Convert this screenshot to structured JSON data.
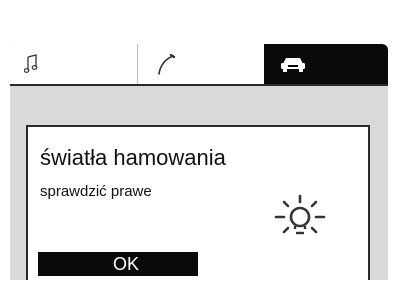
{
  "tabs": [
    {
      "icon": "music-note-icon",
      "selected": false
    },
    {
      "icon": "phone-handset-icon",
      "selected": false
    },
    {
      "icon": "car-icon",
      "selected": true
    }
  ],
  "dialog": {
    "title": "światła hamowania",
    "message": "sprawdzić prawe",
    "icon": "warning-bulb-icon",
    "ok_label": "OK"
  },
  "colors": {
    "screen_background": "#d9d9d9",
    "selected_tab": "#0a0a0a",
    "text": "#111111",
    "button": "#0a0a0a",
    "button_text": "#ffffff"
  }
}
